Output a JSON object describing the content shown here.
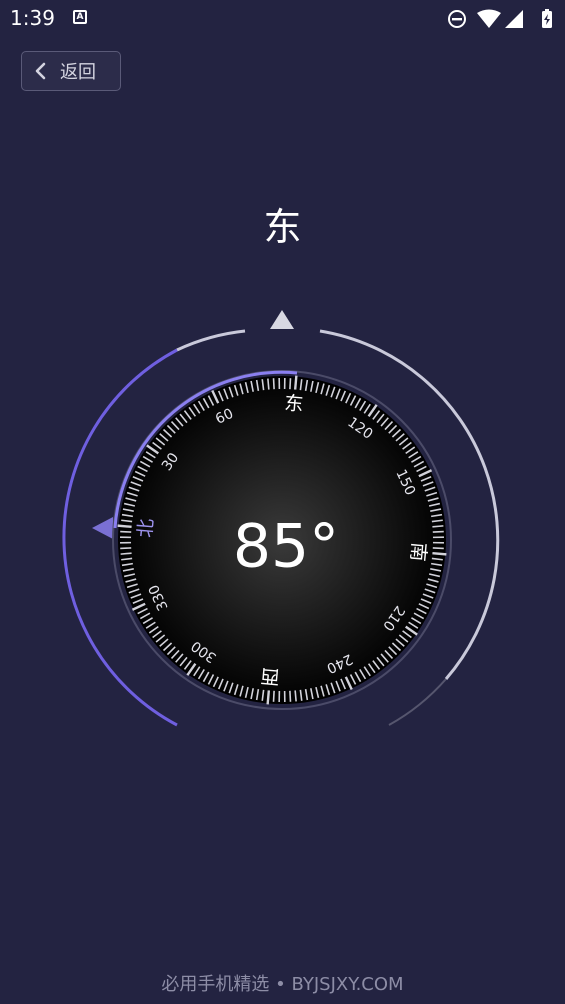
{
  "status_bar": {
    "time": "1:39",
    "notification_icon": "a-app-icon",
    "icons": [
      "do-not-disturb-icon",
      "wifi-icon",
      "signal-icon",
      "battery-charging-icon"
    ]
  },
  "header": {
    "back_label": "返回",
    "back_icon": "chevron-left-icon"
  },
  "compass": {
    "direction": "东",
    "heading_degrees": 85,
    "heading_label": "85°",
    "cardinal_labels": [
      {
        "deg": 0,
        "text": "北"
      },
      {
        "deg": 90,
        "text": "东"
      },
      {
        "deg": 180,
        "text": "南"
      },
      {
        "deg": 270,
        "text": "西"
      }
    ],
    "degree_labels": [
      "30",
      "60",
      "120",
      "150",
      "210",
      "240",
      "300",
      "330"
    ],
    "colors": {
      "background": "#232341",
      "accent": "#6f5fe0",
      "ring": "#c9c9da",
      "dial_center": "#3a3a3a",
      "dial_edge": "#000000"
    }
  },
  "footer": {
    "watermark": "必用手机精选 • BYJSJXY.COM"
  }
}
